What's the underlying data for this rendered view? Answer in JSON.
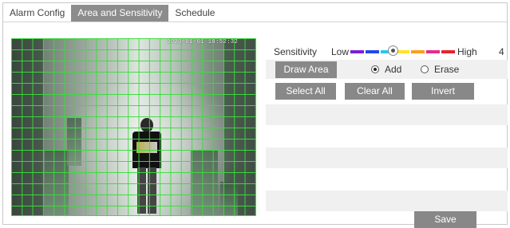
{
  "tabs": [
    {
      "label": "Alarm Config",
      "active": false
    },
    {
      "label": "Area and Sensitivity",
      "active": true
    },
    {
      "label": "Schedule",
      "active": false
    }
  ],
  "video": {
    "osd_text": "2020-01-01 18:52:32",
    "grid": "motion detection area grid (all cells selected)"
  },
  "sensitivity": {
    "label": "Sensitivity",
    "low_label": "Low",
    "high_label": "High",
    "value": "4",
    "level_fraction": 0.4,
    "colors": [
      "#7a1fd6",
      "#2346e8",
      "#29c7e8",
      "#ffe329",
      "#ff9f1c",
      "#e82b8a",
      "#e8232b"
    ]
  },
  "area": {
    "draw_area_label": "Draw Area",
    "add_label": "Add",
    "erase_label": "Erase",
    "mode": "add"
  },
  "actions": {
    "select_all_label": "Select All",
    "clear_all_label": "Clear All",
    "invert_label": "Invert",
    "save_label": "Save"
  },
  "colors": {
    "tab_active_bg": "#8c8c8c",
    "button_bg": "#888888",
    "grid_line": "#3cdc3c",
    "stripe_bg": "#f0f0f0"
  }
}
